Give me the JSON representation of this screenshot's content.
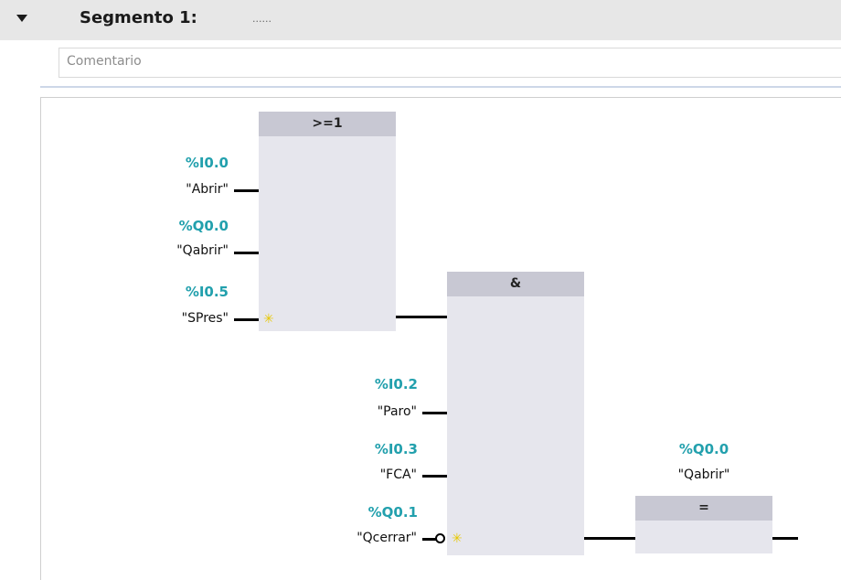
{
  "segment": {
    "title": "Segmento 1:",
    "dots": "......",
    "comment_placeholder": "Comentario"
  },
  "blocks": {
    "or_label": ">=1",
    "and_label": "&",
    "assign_label": "="
  },
  "or_inputs": [
    {
      "address": "%I0.0",
      "tag": "\"Abrir\""
    },
    {
      "address": "%Q0.0",
      "tag": "\"Qabrir\""
    },
    {
      "address": "%I0.5",
      "tag": "\"SPres\""
    }
  ],
  "and_inputs": [
    {
      "address": "%I0.2",
      "tag": "\"Paro\""
    },
    {
      "address": "%I0.3",
      "tag": "\"FCA\""
    },
    {
      "address": "%Q0.1",
      "tag": "\"Qcerrar\""
    }
  ],
  "output": {
    "address": "%Q0.0",
    "tag": "\"Qabrir\""
  },
  "add_input_icon": "sun-star-icon",
  "colors": {
    "address": "#22a0ad",
    "block_body": "#e6e6ed",
    "block_head": "#c8c8d3",
    "add_star": "#e8c800"
  }
}
